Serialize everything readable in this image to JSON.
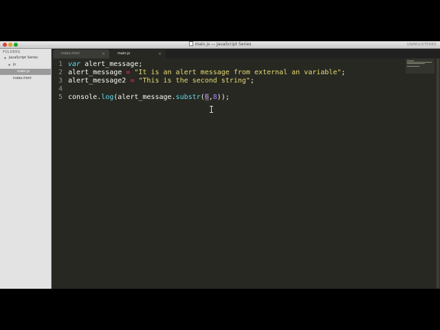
{
  "window": {
    "title": "main.js — JavaScript Series",
    "license_label": "UNREGISTERED"
  },
  "sidebar": {
    "header": "FOLDERS",
    "tree": [
      {
        "label": "JavaScript Series",
        "expander": "▼"
      },
      {
        "label": "js",
        "expander": "▼"
      },
      {
        "label": "main.js",
        "selected": true
      },
      {
        "label": "index.html"
      }
    ]
  },
  "tabs": [
    {
      "label": "index.html",
      "close": "×",
      "active": false
    },
    {
      "label": "main.js",
      "close": "×",
      "active": true
    }
  ],
  "editor": {
    "line_numbers": [
      "1",
      "2",
      "3",
      "4",
      "5"
    ],
    "lines": [
      {
        "t1": "var",
        "t2": " alert_message;"
      },
      {
        "t1": "alert_message",
        "t2": " = ",
        "t3": "\"It is an alert message from external an variable\"",
        "t4": ";"
      },
      {
        "t1": "alert_message2",
        "t2": " = ",
        "t3": "\"This is the second string\"",
        "t4": ";"
      },
      {},
      {
        "t1": "console.",
        "t2": "log",
        "t3": "(alert_message.",
        "t4": "substr",
        "t5": "(",
        "t6": "6",
        "t7": ",",
        "t8": "8",
        "t9": "));"
      }
    ]
  },
  "colors": {
    "background": "#272822",
    "keyword": "#66d9ef",
    "operator": "#f92672",
    "string": "#e6db74",
    "number": "#ae81ff",
    "text": "#f8f8f2"
  }
}
